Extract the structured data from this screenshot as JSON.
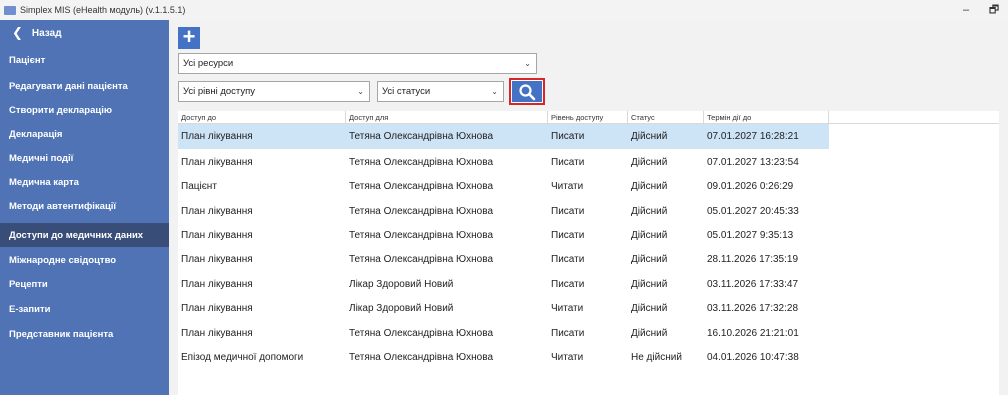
{
  "window": {
    "title": "Simplex MIS (eHealth модуль) (v.1.1.5.1)",
    "minimize_glyph": "–",
    "restore_glyph": "🗗"
  },
  "sidebar": {
    "back_label": "Назад",
    "items": [
      {
        "label": "Пацієнт",
        "active": false
      },
      {
        "label": "Редагувати дані пацієнта",
        "active": false
      },
      {
        "label": "Створити декларацію",
        "active": false
      },
      {
        "label": "Декларація",
        "active": false
      },
      {
        "label": "Медичні події",
        "active": false
      },
      {
        "label": "Медична карта",
        "active": false
      },
      {
        "label": "Методи автентифікації",
        "active": false
      },
      {
        "label": "Доступи до медичних даних",
        "active": true
      },
      {
        "label": "Міжнародне свідоцтво",
        "active": false
      },
      {
        "label": "Рецепти",
        "active": false
      },
      {
        "label": "Е-запити",
        "active": false
      },
      {
        "label": "Представник пацієнта",
        "active": false
      }
    ]
  },
  "toolbar": {
    "add_glyph": "+",
    "resources_filter": "Усі ресурси",
    "access_level_filter": "Усі рівні доступу",
    "status_filter": "Усі статуси"
  },
  "table": {
    "columns": [
      "Доступ до",
      "Доступ для",
      "Рівень доступу",
      "Статус",
      "Термін дії до"
    ],
    "rows": [
      [
        "План лікування",
        "Тетяна Олександрівна Юхнова",
        "Писати",
        "Дійсний",
        "07.01.2027 16:28:21"
      ],
      [
        "План лікування",
        "Тетяна Олександрівна Юхнова",
        "Писати",
        "Дійсний",
        "07.01.2027 13:23:54"
      ],
      [
        "Пацієнт",
        "Тетяна Олександрівна Юхнова",
        "Читати",
        "Дійсний",
        "09.01.2026 0:26:29"
      ],
      [
        "План лікування",
        "Тетяна Олександрівна Юхнова",
        "Писати",
        "Дійсний",
        "05.01.2027 20:45:33"
      ],
      [
        "План лікування",
        "Тетяна Олександрівна Юхнова",
        "Писати",
        "Дійсний",
        "05.01.2027 9:35:13"
      ],
      [
        "План лікування",
        "Тетяна Олександрівна Юхнова",
        "Писати",
        "Дійсний",
        "28.11.2026 17:35:19"
      ],
      [
        "План лікування",
        "Лікар Здоровий Новий",
        "Писати",
        "Дійсний",
        "03.11.2026 17:33:47"
      ],
      [
        "План лікування",
        "Лікар Здоровий Новий",
        "Читати",
        "Дійсний",
        "03.11.2026 17:32:28"
      ],
      [
        "План лікування",
        "Тетяна Олександрівна Юхнова",
        "Писати",
        "Дійсний",
        "16.10.2026 21:21:01"
      ],
      [
        "Епізод медичної допомоги",
        "Тетяна Олександрівна Юхнова",
        "Читати",
        "Не дійсний",
        "04.01.2026 10:47:38"
      ]
    ]
  },
  "colors": {
    "sidebar_bg": "#4f73b5",
    "sidebar_active_bg": "#384d78",
    "accent": "#4472c4",
    "selected_row": "#cde3f6",
    "search_highlight": "#d9252a"
  }
}
